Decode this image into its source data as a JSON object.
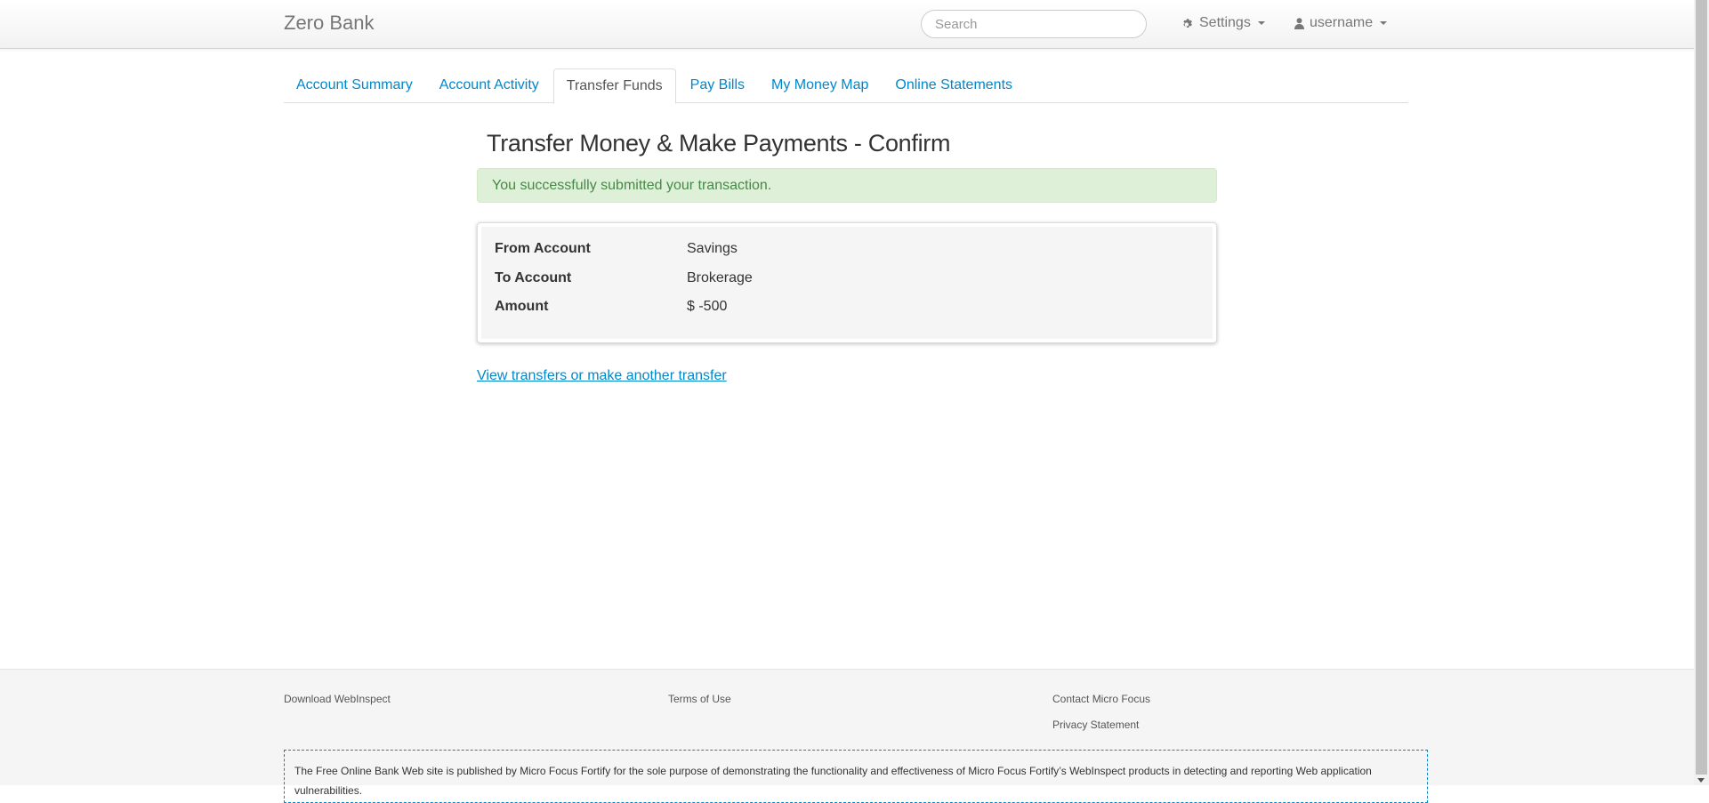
{
  "header": {
    "brand": "Zero Bank",
    "search_placeholder": "Search",
    "settings_label": "Settings",
    "user_label": "username",
    "settings_icon": "gear-icon",
    "user_icon": "user-icon"
  },
  "tabs": [
    {
      "label": "Account Summary",
      "active": false
    },
    {
      "label": "Account Activity",
      "active": false
    },
    {
      "label": "Transfer Funds",
      "active": true
    },
    {
      "label": "Pay Bills",
      "active": false
    },
    {
      "label": "My Money Map",
      "active": false
    },
    {
      "label": "Online Statements",
      "active": false
    }
  ],
  "main": {
    "title": "Transfer Money & Make Payments - Confirm",
    "alert": "You successfully submitted your transaction.",
    "summary": [
      {
        "label": "From Account",
        "value": "Savings"
      },
      {
        "label": "To Account",
        "value": "Brokerage"
      },
      {
        "label": "Amount",
        "value": "$ -500"
      }
    ],
    "link": "View transfers or make another transfer"
  },
  "footer": {
    "links": [
      "Download WebInspect",
      "Terms of Use",
      "Contact Micro Focus",
      "Privacy Statement"
    ],
    "disclaimer": "The Free Online Bank Web site is published by Micro Focus Fortify for the sole purpose of demonstrating the functionality and effectiveness of Micro Focus Fortify’s WebInspect products in detecting and reporting Web application vulnerabilities."
  },
  "colors": {
    "link": "#0088cc",
    "alert_bg": "#dff0d8",
    "alert_text": "#468847"
  }
}
